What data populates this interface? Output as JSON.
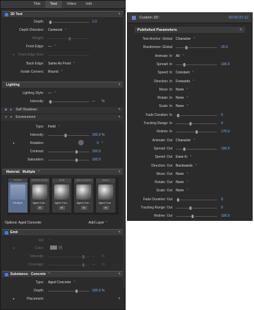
{
  "left": {
    "tabs": [
      "Title",
      "Text",
      "Video",
      "Info"
    ],
    "active_tab": "Text",
    "text3d": {
      "title": "3D Text",
      "depth_label": "Depth:",
      "depth_value": "1.0",
      "depth_direction_label": "Depth Direction:",
      "depth_direction_value": "Centered",
      "weight_label": "Weight:",
      "front_edge_label": "Front Edge:",
      "front_edge_value": "—",
      "front_edge_size_label": "Front Edge Size:",
      "back_edge_label": "Back Edge:",
      "back_edge_value": "Same As Front",
      "inside_corners_label": "Inside Corners:",
      "inside_corners_value": "Round"
    },
    "lighting": {
      "title": "Lighting",
      "lighting_style_label": "Lighting Style:",
      "lighting_style_value": "—",
      "intensity_label": "Intensity:",
      "intensity_unit": "%",
      "self_shadows_label": "Self Shadows:",
      "environment_label": "Environment:",
      "type_label": "Type:",
      "type_value": "Field",
      "env_intensity_label": "Intensity:",
      "env_intensity_value": "100.0",
      "env_intensity_unit": "%",
      "rotation_label": "Rotation:",
      "rotation_value": "0",
      "rotation_unit": "°",
      "contrast_label": "Contrast:",
      "contrast_value": "100.0",
      "saturation_label": "Saturation:",
      "saturation_value": "100.0"
    },
    "material": {
      "title": "Material:",
      "name": "Multiple",
      "tabs": [
        {
          "header": "FRONT",
          "caption": "Multiple"
        },
        {
          "header": "FRONT EDGE",
          "caption": "Aged Con..."
        },
        {
          "header": "SIDE",
          "caption": "Aged Con..."
        },
        {
          "header": "BACK EDGE",
          "caption": "Aged Con..."
        },
        {
          "header": "BACK",
          "caption": "Aged Con..."
        }
      ],
      "options_label": "Options: Aged Concrete",
      "add_layer": "Add Layer"
    },
    "emit": {
      "title": "Emit",
      "fill_label": "Fill:",
      "color_label": "Color:",
      "intensity_label": "Intensity:",
      "intensity_unit": "%",
      "coverage_label": "Coverage:",
      "coverage_unit": "%"
    },
    "substance": {
      "title": "Substance:",
      "name": "Concrete",
      "type_label": "Type:",
      "type_value": "Aged Concrete",
      "depth_label": "Depth:",
      "depth_value": "100.0",
      "depth_unit": "%",
      "placement_label": "Placement:"
    }
  },
  "right": {
    "title": "Custom 3D:",
    "timecode": "00:00:21:12",
    "published_title": "Published Parameters",
    "rows": [
      {
        "label": "Text Anchor: Global",
        "value": "Character",
        "kind": "select"
      },
      {
        "label": "Randomize: Global",
        "value": "29.0",
        "kind": "slider",
        "pos": 0.25
      },
      {
        "label": "Animate: In",
        "value": "All",
        "kind": "select"
      },
      {
        "label": "Spread: In",
        "value": "100.0",
        "kind": "slider",
        "pos": 0.2
      },
      {
        "label": "Speed: In",
        "value": "Constant",
        "kind": "select"
      },
      {
        "label": "Direction: In",
        "value": "Forwards",
        "kind": "select"
      },
      {
        "label": "Move: In",
        "value": "None",
        "kind": "select"
      },
      {
        "label": "Rotate: In",
        "value": "None",
        "kind": "select"
      },
      {
        "label": "Scale: In",
        "value": "None",
        "kind": "select"
      },
      {
        "label": "Fade Duration: In",
        "value": "0",
        "kind": "slider",
        "pos": 0.03
      },
      {
        "label": "Tracking Range: In",
        "value": "0",
        "kind": "slider",
        "pos": 0.35
      },
      {
        "label": "Retime: In",
        "value": "170.0",
        "kind": "slider",
        "pos": 0.5
      },
      {
        "label": "Animate: Out",
        "value": "Character",
        "kind": "select"
      },
      {
        "label": "Spread: Out",
        "value": "100.0",
        "kind": "slider",
        "pos": 0.2
      },
      {
        "label": "Speed: Out",
        "value": "Ease In",
        "kind": "select"
      },
      {
        "label": "Direction: Out",
        "value": "Backwards",
        "kind": "select"
      },
      {
        "label": "Move: Out",
        "value": "None",
        "kind": "select"
      },
      {
        "label": "Rotate: Out",
        "value": "None",
        "kind": "select"
      },
      {
        "label": "Scale: Out",
        "value": "None",
        "kind": "select"
      },
      {
        "label": "Fade Duration: Out",
        "value": "0",
        "kind": "slider",
        "pos": 0.03
      },
      {
        "label": "Tracking Range: Out",
        "value": "0",
        "kind": "slider",
        "pos": 0.35
      },
      {
        "label": "Retime: Out",
        "value": "100.0",
        "kind": "slider",
        "pos": 0.4
      }
    ]
  },
  "colors": {
    "accent": "#3b7cff",
    "panel": "#2b2b2b",
    "value_blue": "#7ab0ff"
  }
}
